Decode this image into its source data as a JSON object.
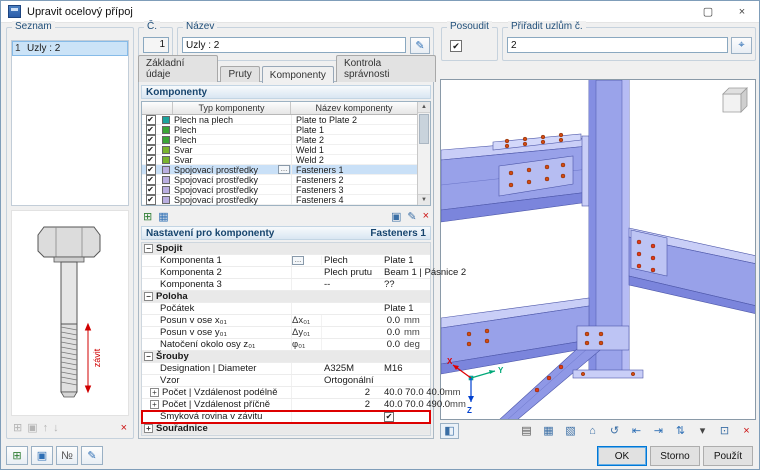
{
  "window": {
    "title": "Upravit ocelový přípoj",
    "controls": [
      {
        "name": "maximize-button",
        "glyph": "▢"
      },
      {
        "name": "close-button",
        "glyph": "×"
      }
    ]
  },
  "header": {
    "number": {
      "label": "Č.",
      "value": "1"
    },
    "name": {
      "label": "Název",
      "value": "Uzly : 2",
      "edit_icon": "✎"
    },
    "check": {
      "label": "Posoudit",
      "checked": true
    },
    "assign": {
      "label": "Přiřadit uzlům č.",
      "value": "2",
      "pick_icon": "⌖"
    }
  },
  "left_panel": {
    "title": "Seznam",
    "items": [
      {
        "number": "1",
        "label": "Uzly : 2",
        "selected": true
      }
    ],
    "bolt_annotation": "závit",
    "toolbar": [
      {
        "name": "list-new-icon",
        "glyph": "⊞",
        "disabled": true
      },
      {
        "name": "list-copy-icon",
        "glyph": "▣",
        "disabled": true
      },
      {
        "name": "list-up-icon",
        "glyph": "↑",
        "disabled": true
      },
      {
        "name": "list-down-icon",
        "glyph": "↓",
        "disabled": true
      },
      {
        "name": "list-delete-button",
        "glyph": "×",
        "color": "#cc1111"
      }
    ],
    "footer_buttons": [
      {
        "name": "new-connection-button",
        "glyph": "⊞",
        "color": "#2e7d32"
      },
      {
        "name": "copy-connection-button",
        "glyph": "▣",
        "color": "#2e6fb5"
      },
      {
        "name": "renumber-button",
        "glyph": "№",
        "color": "#555555"
      },
      {
        "name": "settings-button",
        "glyph": "✎",
        "color": "#2e6fb5"
      }
    ]
  },
  "tabs": [
    {
      "label": "Základní údaje",
      "active": false
    },
    {
      "label": "Pruty",
      "active": false
    },
    {
      "label": "Komponenty",
      "active": true
    },
    {
      "label": "Kontrola správnosti",
      "active": false
    }
  ],
  "components": {
    "title": "Komponenty",
    "columns": [
      "Typ komponenty",
      "Název komponenty"
    ],
    "rows": [
      {
        "checked": true,
        "color": "#1ba39c",
        "type": "Plech na plech",
        "name": "Plate to Plate 2"
      },
      {
        "checked": true,
        "color": "#3aa636",
        "type": "Plech",
        "name": "Plate 1"
      },
      {
        "checked": true,
        "color": "#3aa636",
        "type": "Plech",
        "name": "Plate 2"
      },
      {
        "checked": true,
        "color": "#7ab52e",
        "type": "Svar",
        "name": "Weld 1"
      },
      {
        "checked": true,
        "color": "#7ab52e",
        "type": "Svar",
        "name": "Weld 2"
      },
      {
        "checked": true,
        "color": "#b9aee0",
        "type": "Spojovací prostředky",
        "name": "Fasteners 1",
        "selected": true
      },
      {
        "checked": true,
        "color": "#b9aee0",
        "type": "Spojovací prostředky",
        "name": "Fasteners 2"
      },
      {
        "checked": true,
        "color": "#b9aee0",
        "type": "Spojovací prostředky",
        "name": "Fasteners 3"
      },
      {
        "checked": true,
        "color": "#b9aee0",
        "type": "Spojovací prostředky",
        "name": "Fasteners 4"
      }
    ],
    "toolbar_left": [
      {
        "name": "add-component-button",
        "glyph": "⊞",
        "color": "#2e7d32"
      },
      {
        "name": "component-library-button",
        "glyph": "▦",
        "color": "#2e6fb5"
      }
    ],
    "toolbar_right": [
      {
        "name": "copy-component-button",
        "glyph": "▣",
        "color": "#3a6ea5"
      },
      {
        "name": "edit-component-button",
        "glyph": "✎",
        "color": "#3a6ea5"
      },
      {
        "name": "delete-component-button",
        "glyph": "×",
        "color": "#cc1111"
      }
    ]
  },
  "settings": {
    "title": "Nastavení pro komponenty",
    "subtitle": "Fasteners 1",
    "rows": [
      {
        "kind": "group",
        "label": "Spojit",
        "name": "group-spojit",
        "expanded": true
      },
      {
        "kind": "component",
        "label": "Komponenta 1",
        "val1": "Plech",
        "val2": "Plate 1",
        "picker": true,
        "name": "row-komponenta-1"
      },
      {
        "kind": "component",
        "label": "Komponenta 2",
        "val1": "Plech prutu",
        "val2": "Beam 1 | Pásnice 2",
        "name": "row-komponenta-2"
      },
      {
        "kind": "component",
        "label": "Komponenta 3",
        "val1": "--",
        "val2": "??",
        "name": "row-komponenta-3"
      },
      {
        "kind": "group",
        "label": "Poloha",
        "name": "group-poloha",
        "expanded": true
      },
      {
        "kind": "text",
        "label": "Počátek",
        "val": "Plate 1",
        "col": 2,
        "name": "row-pocatek"
      },
      {
        "kind": "number",
        "label": "Posun v ose x₀₁",
        "sym": "Δx₀₁",
        "val": "0.0",
        "unit": "mm",
        "name": "row-posun-x"
      },
      {
        "kind": "number",
        "label": "Posun v ose y₀₁",
        "sym": "Δy₀₁",
        "val": "0.0",
        "unit": "mm",
        "name": "row-posun-y"
      },
      {
        "kind": "number",
        "label": "Natočení okolo osy z₀₁",
        "sym": "φ₀₁",
        "val": "0.0",
        "unit": "deg",
        "name": "row-natoceni-z"
      },
      {
        "kind": "group",
        "label": "Šrouby",
        "name": "group-srouby",
        "expanded": true
      },
      {
        "kind": "pair",
        "label": "Designation | Diameter",
        "val1": "A325M",
        "val2": "M16",
        "name": "row-designation-diameter"
      },
      {
        "kind": "text",
        "label": "Vzor",
        "val": "Ortogonální",
        "col": 1,
        "name": "row-vzor"
      },
      {
        "kind": "countlist",
        "label": "Počet | Vzdálenost podélně",
        "count": "2",
        "list": "40.0 70.0 40.0",
        "unit": "mm",
        "expandable": true,
        "name": "row-pocet-podelne"
      },
      {
        "kind": "countlist",
        "label": "Počet | Vzdálenost příčně",
        "count": "2",
        "list": "40.0 70.0 490.0",
        "unit": "mm",
        "expandable": true,
        "name": "row-pocet-pricne"
      },
      {
        "kind": "check",
        "label": "Smyková rovina v závitu",
        "checked": true,
        "highlight": true,
        "name": "row-smykova-rovina"
      },
      {
        "kind": "group",
        "label": "Souřadnice",
        "name": "group-souradnice",
        "expanded": false
      }
    ]
  },
  "viewport": {
    "axes": {
      "x": "X",
      "y": "Y",
      "z": "Z"
    },
    "corner_button": {
      "name": "viewport-panel-button",
      "glyph": "◧"
    },
    "toolbar": [
      {
        "name": "select-mode-icon",
        "glyph": "▤",
        "color": "#555555"
      },
      {
        "name": "shaded-view-icon",
        "glyph": "▦",
        "color": "#3a6ea5"
      },
      {
        "name": "wireframe-view-icon",
        "glyph": "▧",
        "color": "#3a6ea5"
      },
      {
        "name": "zoom-extents-icon",
        "glyph": "⌂",
        "color": "#3a6ea5"
      },
      {
        "name": "rotate-view-icon",
        "glyph": "↺",
        "color": "#3a6ea5"
      },
      {
        "name": "dimension-x-icon",
        "glyph": "⇤",
        "color": "#2e6fb5"
      },
      {
        "name": "dimension-y-icon",
        "glyph": "⇥",
        "color": "#2e6fb5"
      },
      {
        "name": "dimension-z-icon",
        "glyph": "⇅",
        "color": "#2e6fb5"
      },
      {
        "name": "display-options-icon",
        "glyph": "▾",
        "color": "#444444"
      },
      {
        "name": "print-icon",
        "glyph": "⊡",
        "color": "#3a6ea5"
      },
      {
        "name": "close-view-icon",
        "glyph": "×",
        "color": "#cc1111"
      }
    ]
  },
  "footer": {
    "ok": "OK",
    "cancel": "Storno",
    "apply": "Použít"
  }
}
